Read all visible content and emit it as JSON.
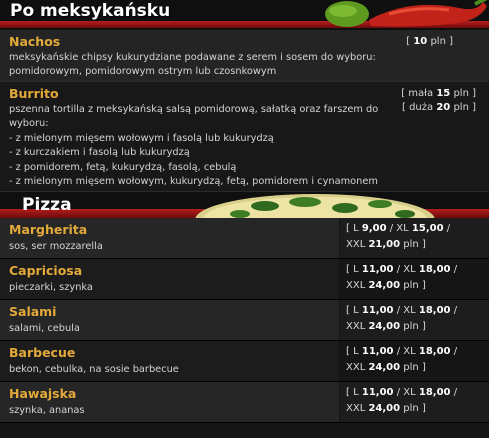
{
  "mexican": {
    "title": "Po meksykańsku",
    "items": [
      {
        "name": "Nachos",
        "desc": [
          "meksykańskie chipsy kukurydziane podawane z serem i sosem do wyboru:",
          "pomidorowym, pomidorowym ostrym lub czosnkowym"
        ],
        "prices": [
          {
            "label": "",
            "value": "10",
            "unit": "pln"
          }
        ]
      },
      {
        "name": "Burrito",
        "desc": [
          "pszenna tortilla z meksykańską salsą pomidorową, sałatką oraz farszem do",
          "wyboru:",
          "- z mielonym mięsem wołowym i fasolą lub kukurydzą",
          "- z kurczakiem i fasolą lub kukurydzą",
          "- z pomidorem, fetą, kukurydzą, fasolą, cebulą",
          "- z mielonym mięsem wołowym, kukurydzą, fetą, pomidorem i cynamonem"
        ],
        "prices": [
          {
            "label": "mała",
            "value": "15",
            "unit": "pln"
          },
          {
            "label": "duża",
            "value": "20",
            "unit": "pln"
          }
        ]
      }
    ]
  },
  "pizza": {
    "title": "Pizza",
    "items": [
      {
        "name": "Margherita",
        "desc": "sos, ser mozzarella",
        "L": "9,00",
        "XL": "15,00",
        "XXL": "21,00",
        "unit": "pln"
      },
      {
        "name": "Capriciosa",
        "desc": "pieczarki, szynka",
        "L": "11,00",
        "XL": "18,00",
        "XXL": "24,00",
        "unit": "pln"
      },
      {
        "name": "Salami",
        "desc": "salami, cebula",
        "L": "11,00",
        "XL": "18,00",
        "XXL": "24,00",
        "unit": "pln"
      },
      {
        "name": "Barbecue",
        "desc": "bekon, cebulka, na sosie barbecue",
        "L": "11,00",
        "XL": "18,00",
        "XXL": "24,00",
        "unit": "pln"
      },
      {
        "name": "Hawajska",
        "desc": "szynka, ananas",
        "L": "11,00",
        "XL": "18,00",
        "XXL": "24,00",
        "unit": "pln"
      }
    ]
  },
  "labels": {
    "L": "L",
    "XL": "XL",
    "XXL": "XXL",
    "open": "[",
    "close": "]",
    "sep": "/"
  },
  "colors": {
    "accent": "#e3a93a",
    "red": "#b51e1e"
  },
  "icons": [
    "chili-pepper-icon",
    "pizza-image"
  ]
}
